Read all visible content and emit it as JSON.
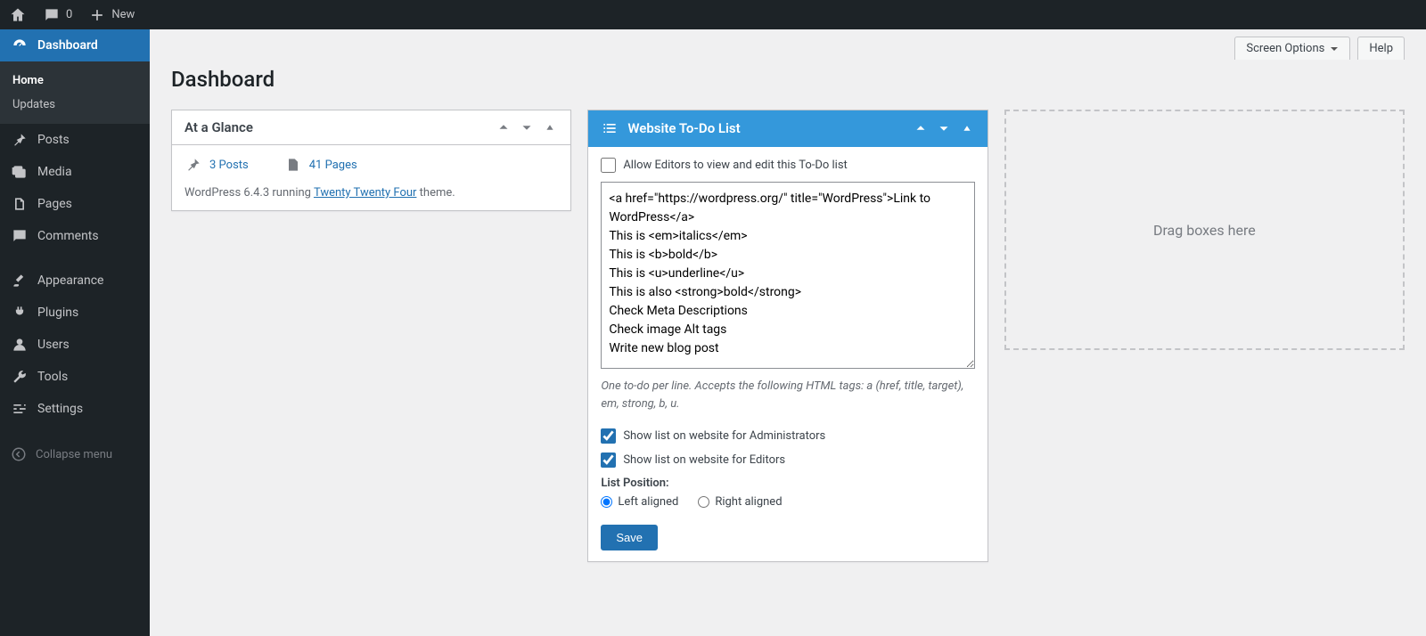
{
  "toolbar": {
    "comment_count": "0",
    "new_label": "New"
  },
  "sidebar": {
    "dashboard": "Dashboard",
    "home": "Home",
    "updates": "Updates",
    "posts": "Posts",
    "media": "Media",
    "pages": "Pages",
    "comments": "Comments",
    "appearance": "Appearance",
    "plugins": "Plugins",
    "users": "Users",
    "tools": "Tools",
    "settings": "Settings",
    "collapse": "Collapse menu"
  },
  "header_tabs": {
    "screen_options": "Screen Options",
    "help": "Help"
  },
  "page": {
    "title": "Dashboard"
  },
  "widgets": {
    "glance": {
      "title": "At a Glance",
      "posts": "3 Posts",
      "pages": "41 Pages",
      "status_prefix": "WordPress 6.4.3 running ",
      "theme_link": "Twenty Twenty Four",
      "status_suffix": " theme."
    },
    "todo": {
      "title": "Website To-Do List",
      "allow_editors_label": "Allow Editors to view and edit this To-Do list",
      "allow_editors_checked": false,
      "textarea_value": "<a href=\"https://wordpress.org/\" title=\"WordPress\">Link to WordPress</a>\nThis is <em>italics</em>\nThis is <b>bold</b>\nThis is <u>underline</u>\nThis is also <strong>bold</strong>\nCheck Meta Descriptions\nCheck image Alt tags\nWrite new blog post",
      "help_text": "One to-do per line. Accepts the following HTML tags: a (href, title, target), em, strong, b, u.",
      "show_admin_label": "Show list on website for Administrators",
      "show_admin_checked": true,
      "show_editors_label": "Show list on website for Editors",
      "show_editors_checked": true,
      "position_label": "List Position:",
      "position_left": "Left aligned",
      "position_right": "Right aligned",
      "position_selected": "left",
      "save_label": "Save"
    },
    "dropzone": {
      "text": "Drag boxes here"
    }
  }
}
